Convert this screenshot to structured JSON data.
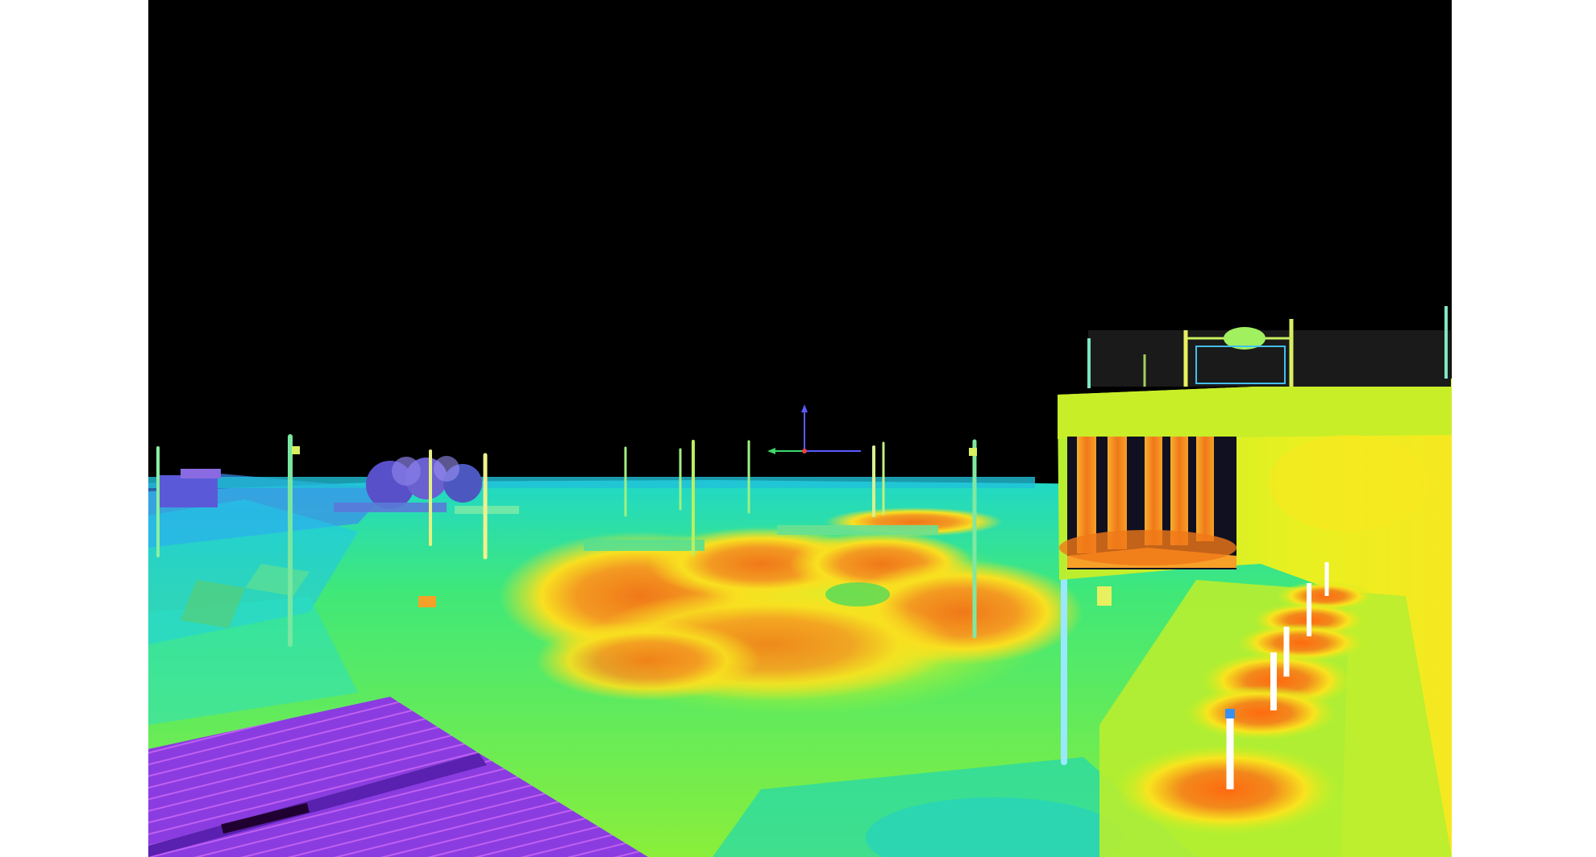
{
  "scene": {
    "type": "false-color illuminance render",
    "background": "#ffffff",
    "sky_color": "#000000",
    "palette": {
      "low": "#8a3fe0",
      "low_mid": "#20d8e0",
      "mid": "#36e850",
      "mid_high": "#c8f020",
      "high": "#f8e818",
      "peak": "#f07a18"
    }
  },
  "icons": {
    "axis_gizmo": "axis-gizmo-icon"
  }
}
